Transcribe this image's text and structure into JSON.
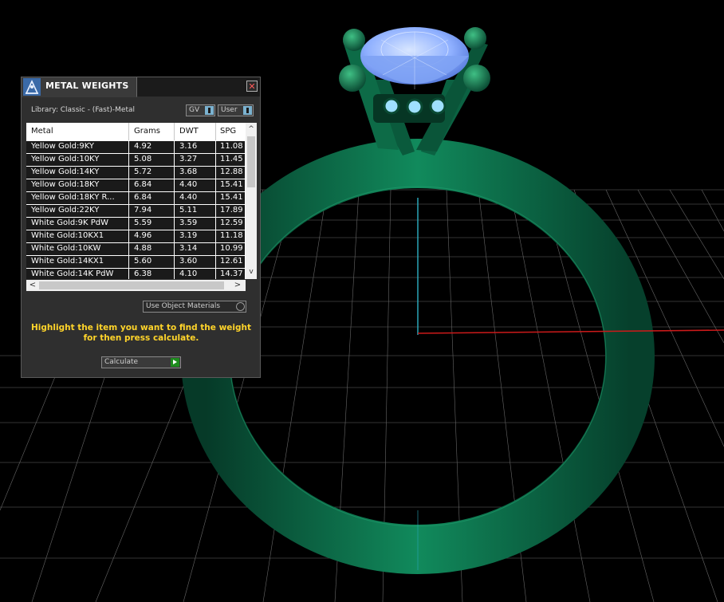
{
  "panel": {
    "title": "METAL WEIGHTS",
    "close_glyph": "✕",
    "library_label": "Library: Classic - (Fast)-Metal",
    "gv_dropdown": "GV",
    "user_dropdown": "User",
    "table": {
      "columns": [
        "Metal",
        "Grams",
        "DWT",
        "SPG"
      ],
      "rows": [
        [
          "Yellow Gold:9KY",
          "4.92",
          "3.16",
          "11.08"
        ],
        [
          "Yellow Gold:10KY",
          "5.08",
          "3.27",
          "11.45"
        ],
        [
          "Yellow Gold:14KY",
          "5.72",
          "3.68",
          "12.88"
        ],
        [
          "Yellow Gold:18KY",
          "6.84",
          "4.40",
          "15.41"
        ],
        [
          "Yellow Gold:18KY R...",
          "6.84",
          "4.40",
          "15.41"
        ],
        [
          "Yellow Gold:22KY",
          "7.94",
          "5.11",
          "17.89"
        ],
        [
          "White Gold:9K PdW",
          "5.59",
          "3.59",
          "12.59"
        ],
        [
          "White Gold:10KX1",
          "4.96",
          "3.19",
          "11.18"
        ],
        [
          "White Gold:10KW",
          "4.88",
          "3.14",
          "10.99"
        ],
        [
          "White Gold:14KX1",
          "5.60",
          "3.60",
          "12.61"
        ],
        [
          "White Gold:14K PdW",
          "6.38",
          "4.10",
          "14.37"
        ]
      ]
    },
    "scroll_up_glyph": "^",
    "scroll_down_glyph": "v",
    "scroll_left_glyph": "<",
    "scroll_right_glyph": ">",
    "use_object_materials": "Use Object Materials",
    "instruction_line1": "Highlight the item you want to find the weight",
    "instruction_line2": "for then press calculate.",
    "calculate_label": "Calculate"
  },
  "colors": {
    "ring": "#0f6e4a",
    "gem": "#8fb3ff",
    "grid": "#8a8a8a",
    "instruction": "#ffd42a",
    "axis_x": "#cc1a1a",
    "axis_y": "#2aa6b8"
  }
}
